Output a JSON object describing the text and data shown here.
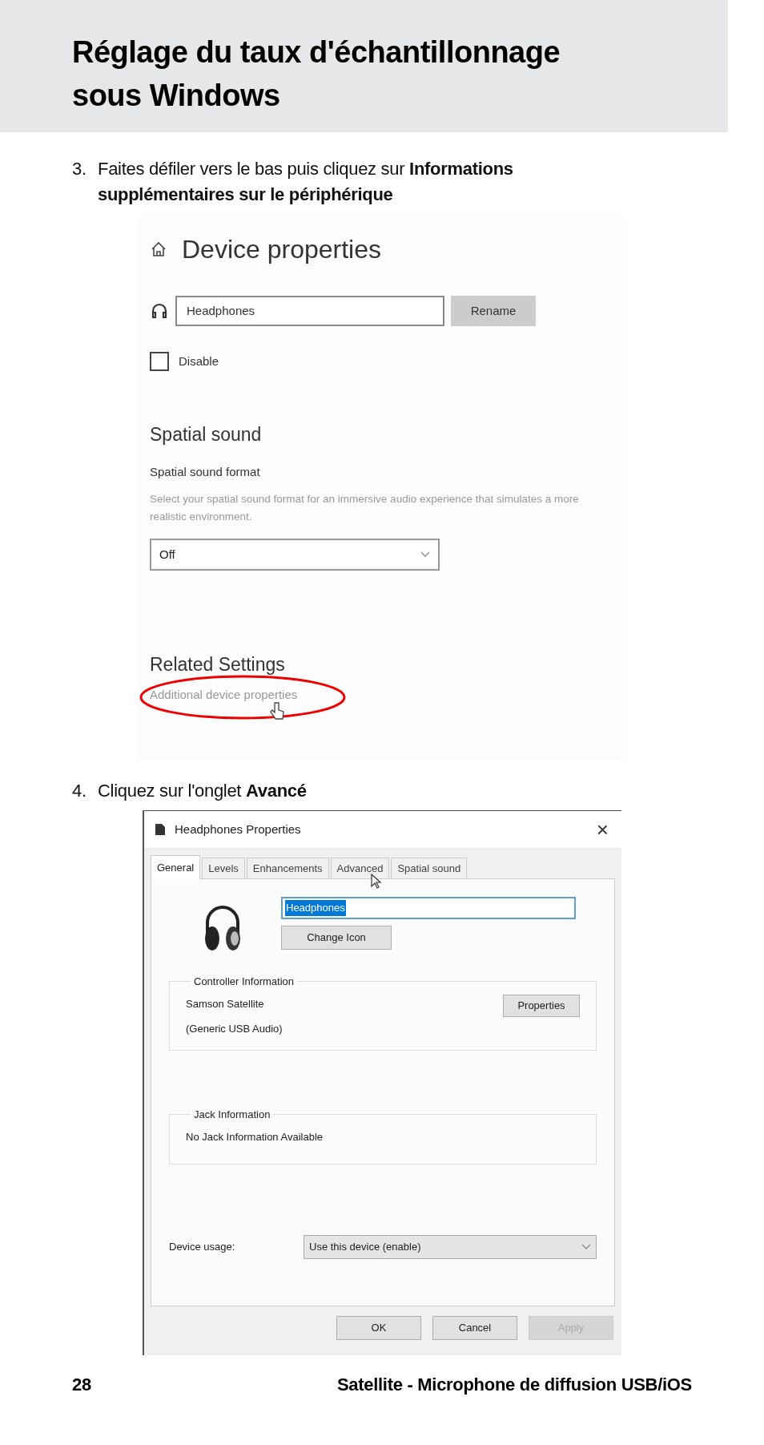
{
  "header": {
    "title": "Réglage du taux d'échantillonnage sous Windows"
  },
  "step_1": {
    "number": "3.",
    "text": "Faites défiler vers le bas puis cliquez sur **Informations supplémentaires sur le périphérique**"
  },
  "screenshot_1": {
    "title": "Device properties",
    "name_field": {
      "value": "Headphones"
    },
    "rename_button": "Rename",
    "disable_checkbox": {
      "label": "Disable",
      "checked": false
    },
    "section_title": "Spatial sound",
    "format_label": "Spatial sound format",
    "format_description": "Select your spatial sound format for an immersive audio experience that simulates a more realistic environment.",
    "format_select": {
      "value": "Off"
    },
    "related_title": "Related Settings",
    "related_link": "Additional device properties"
  },
  "step_2": {
    "number": "4.",
    "text": "Cliquez sur l'onglet **Avancé**"
  },
  "screenshot_2": {
    "window_title": "Headphones Properties",
    "close": "×",
    "tabs": [
      {
        "label": "General",
        "selected": true
      },
      {
        "label": "Levels",
        "selected": false
      },
      {
        "label": "Enhancements",
        "selected": false
      },
      {
        "label": "Advanced",
        "selected": false
      },
      {
        "label": "Spatial sound",
        "selected": false
      }
    ],
    "name_field": {
      "value": "Headphones"
    },
    "change_icon_button": "Change Icon",
    "controller_group": {
      "title": "Controller Information",
      "name": "Samson Satellite",
      "driver": "(Generic USB Audio)",
      "button": "Properties"
    },
    "jack_group": {
      "title": "Jack Information",
      "text": "No Jack Information Available"
    },
    "device_usage": {
      "label": "Device usage:",
      "value": "Use this device (enable)"
    },
    "buttons": [
      {
        "label": "OK",
        "disabled": false
      },
      {
        "label": "Cancel",
        "disabled": false
      },
      {
        "label": "Apply",
        "disabled": true
      }
    ]
  },
  "footer": {
    "page_number": "28",
    "title": "Satellite - Microphone de diffusion USB/iOS"
  }
}
